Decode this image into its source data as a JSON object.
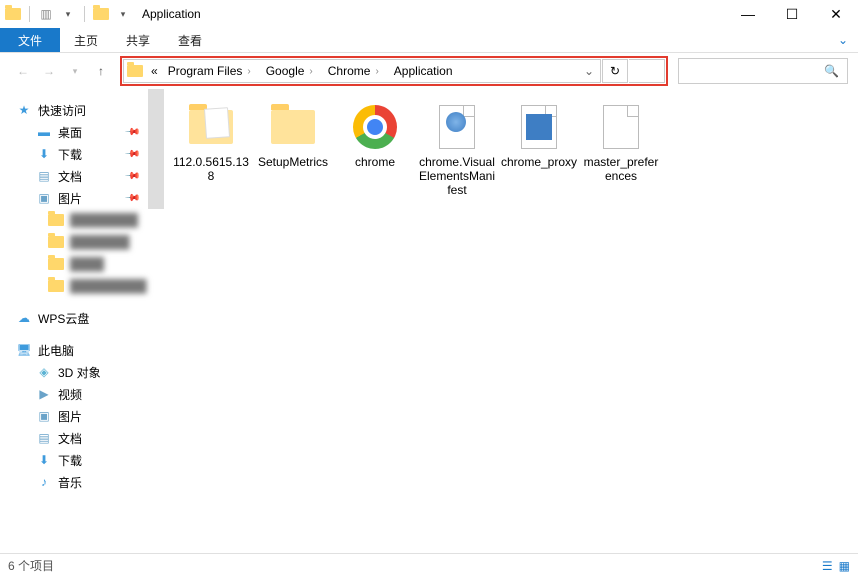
{
  "window": {
    "title": "Application"
  },
  "ribbon": {
    "file": "文件",
    "tabs": [
      "主页",
      "共享",
      "查看"
    ]
  },
  "breadcrumb": {
    "parts": [
      "Program Files",
      "Google",
      "Chrome",
      "Application"
    ]
  },
  "sidebar": {
    "quick_access": {
      "label": "快速访问",
      "items": [
        {
          "label": "桌面",
          "pinned": true,
          "icon": "desktop"
        },
        {
          "label": "下载",
          "pinned": true,
          "icon": "download"
        },
        {
          "label": "文档",
          "pinned": true,
          "icon": "document"
        },
        {
          "label": "图片",
          "pinned": true,
          "icon": "picture"
        }
      ],
      "blurred": [
        "████████",
        "███████",
        "████",
        "█████████"
      ]
    },
    "wps": {
      "label": "WPS云盘"
    },
    "thispc": {
      "label": "此电脑",
      "items": [
        {
          "label": "3D 对象",
          "icon": "3d"
        },
        {
          "label": "视频",
          "icon": "video"
        },
        {
          "label": "图片",
          "icon": "picture"
        },
        {
          "label": "文档",
          "icon": "document"
        },
        {
          "label": "下载",
          "icon": "download"
        },
        {
          "label": "音乐",
          "icon": "music"
        }
      ]
    }
  },
  "files": [
    {
      "name": "112.0.5615.138",
      "type": "folder-hasfile"
    },
    {
      "name": "SetupMetrics",
      "type": "folder"
    },
    {
      "name": "chrome",
      "type": "chrome"
    },
    {
      "name": "chrome.VisualElementsManifest",
      "type": "html"
    },
    {
      "name": "chrome_proxy",
      "type": "bluefile"
    },
    {
      "name": "master_preferences",
      "type": "blank"
    }
  ],
  "status": {
    "count": "6 个项目"
  }
}
